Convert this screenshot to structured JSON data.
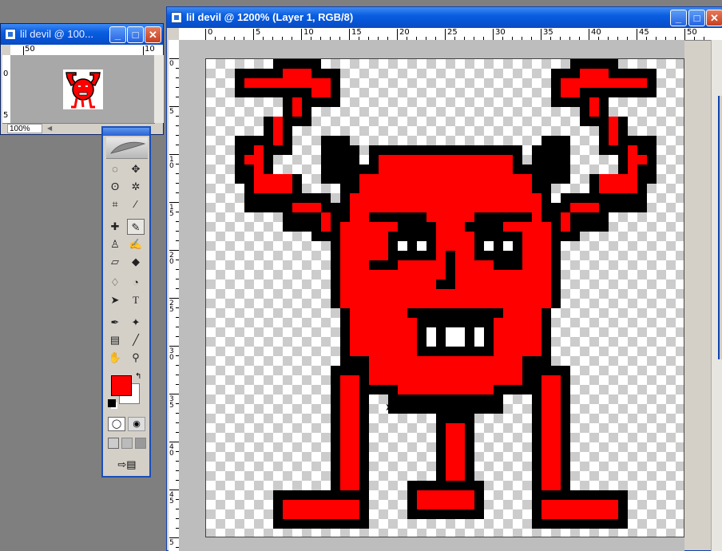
{
  "navigator": {
    "title": "lil devil @ 100...",
    "zoom_value": "100%",
    "ruler_labels": [
      "50",
      "10"
    ],
    "ruler_v_labels": [
      "0",
      "5"
    ]
  },
  "main": {
    "title": "lil devil @ 1200% (Layer 1, RGB/8)",
    "ruler_labels": [
      "0",
      "5",
      "10",
      "15",
      "20",
      "25",
      "30",
      "35",
      "40",
      "45",
      "50"
    ],
    "ruler_v_labels": [
      "0",
      "5",
      "1 0",
      "1 5",
      "2 0",
      "2 5",
      "3 0",
      "3 5",
      "4 0",
      "4 5",
      "5"
    ]
  },
  "window_buttons": {
    "minimize": "_",
    "maximize": "□",
    "close": "✕"
  },
  "toolbox": {
    "tools": [
      "marquee-icon",
      "move-icon",
      "lasso-icon",
      "magic-wand-icon",
      "crop-icon",
      "slice-icon",
      "healing-brush-icon",
      "pencil-icon",
      "clone-stamp-icon",
      "history-brush-icon",
      "eraser-icon",
      "paint-bucket-icon",
      "blur-icon",
      "dodge-icon",
      "path-select-icon",
      "type-icon",
      "pen-icon",
      "custom-shape-icon",
      "notes-icon",
      "eyedropper-icon",
      "hand-icon",
      "zoom-icon"
    ],
    "selected_tool": "pencil-icon",
    "foreground_color": "#ff0000",
    "background_color": "#ffffff"
  },
  "colors": {
    "devil_red": "#ff0000",
    "outline": "#000000",
    "eyes": "#ffffff"
  }
}
